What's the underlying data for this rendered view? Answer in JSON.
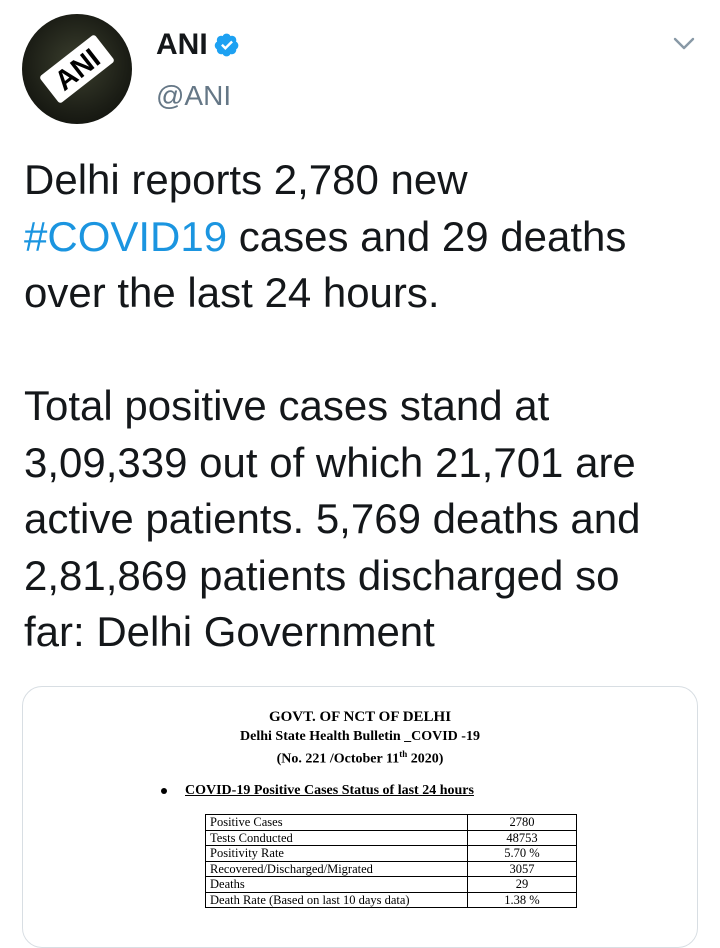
{
  "author": {
    "name": "ANI",
    "handle": "@ANI",
    "avatar_text": "ANI",
    "verified": true
  },
  "tweet": {
    "text_before_hashtag": "Delhi reports 2,780 new\n",
    "hashtag": "#COVID19",
    "text_after_hashtag": " cases and 29 deaths\nover the last 24 hours.\n\nTotal positive cases stand at\n3,09,339 out of which 21,701 are\nactive patients. 5,769 deaths and\n2,81,869 patients discharged so\nfar: Delhi Government"
  },
  "icons": {
    "verified": "verified-badge-icon",
    "menu": "chevron-down-icon"
  },
  "colors": {
    "hashtag": "#1b95e0",
    "verified": "#1da1f2",
    "handle": "#657786"
  },
  "bulletin": {
    "header_line1": "GOVT. OF NCT OF DELHI",
    "header_line2": "Delhi State Health Bulletin _COVID -19",
    "header_line3_pre": "(No. 221 /October 11",
    "header_line3_sup": "th",
    "header_line3_post": " 2020)",
    "section_title": "COVID-19 Positive Cases Status of last 24 hours",
    "rows": [
      {
        "label": "Positive Cases",
        "value": "2780"
      },
      {
        "label": "Tests Conducted",
        "value": "48753"
      },
      {
        "label": "Positivity Rate",
        "value": "5.70 %"
      },
      {
        "label": "Recovered/Discharged/Migrated",
        "value": "3057"
      },
      {
        "label": "Deaths",
        "value": "29"
      },
      {
        "label": "Death Rate (Based on last 10 days data)",
        "value": "1.38 %"
      }
    ]
  }
}
